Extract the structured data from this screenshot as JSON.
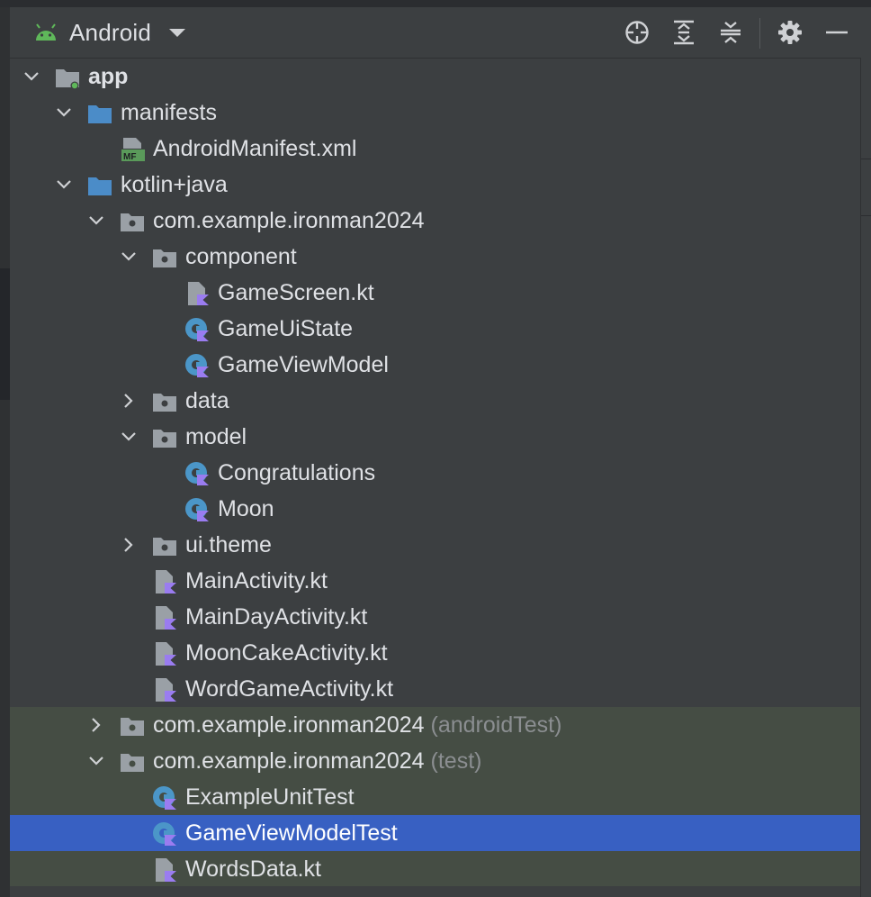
{
  "toolbar": {
    "view_mode": "Android",
    "icons": [
      "android-icon",
      "dropdown-chevron-icon",
      "locate-target-icon",
      "expand-all-icon",
      "collapse-all-icon",
      "gear-icon",
      "minimize-icon"
    ]
  },
  "tree": [
    {
      "label": "app",
      "expanded": true,
      "icon": "module-folder-icon",
      "bold": true
    },
    {
      "label": "manifests",
      "expanded": true,
      "icon": "folder-icon"
    },
    {
      "label": "AndroidManifest.xml",
      "icon": "manifest-file-icon"
    },
    {
      "label": "kotlin+java",
      "expanded": true,
      "icon": "folder-icon"
    },
    {
      "label": "com.example.ironman2024",
      "expanded": true,
      "icon": "package-icon"
    },
    {
      "label": "component",
      "expanded": true,
      "icon": "package-icon"
    },
    {
      "label": "GameScreen.kt",
      "icon": "kotlin-file-icon"
    },
    {
      "label": "GameUiState",
      "icon": "kotlin-class-icon"
    },
    {
      "label": "GameViewModel",
      "icon": "kotlin-class-icon"
    },
    {
      "label": "data",
      "expanded": false,
      "icon": "package-icon"
    },
    {
      "label": "model",
      "expanded": true,
      "icon": "package-icon"
    },
    {
      "label": "Congratulations",
      "icon": "kotlin-class-icon"
    },
    {
      "label": "Moon",
      "icon": "kotlin-class-icon"
    },
    {
      "label": "ui.theme",
      "expanded": false,
      "icon": "package-icon"
    },
    {
      "label": "MainActivity.kt",
      "icon": "kotlin-file-icon"
    },
    {
      "label": "MainDayActivity.kt",
      "icon": "kotlin-file-icon"
    },
    {
      "label": "MoonCakeActivity.kt",
      "icon": "kotlin-file-icon"
    },
    {
      "label": "WordGameActivity.kt",
      "icon": "kotlin-file-icon"
    },
    {
      "label": "com.example.ironman2024",
      "suffix": "(androidTest)",
      "expanded": false,
      "icon": "package-icon"
    },
    {
      "label": "com.example.ironman2024",
      "suffix": "(test)",
      "expanded": true,
      "icon": "package-icon"
    },
    {
      "label": "ExampleUnitTest",
      "icon": "kotlin-class-icon"
    },
    {
      "label": "GameViewModelTest",
      "icon": "kotlin-class-icon",
      "selected": true
    },
    {
      "label": "WordsData.kt",
      "icon": "kotlin-file-icon"
    }
  ],
  "colors": {
    "panel_bg": "#3c3f41",
    "test_highlight": "#454d44",
    "selection": "#3860c2",
    "folder_blue": "#4b8cc8",
    "kotlin_purple": "#9a7cf0",
    "class_teal": "#4b96c8",
    "android_green": "#5fb85a"
  }
}
